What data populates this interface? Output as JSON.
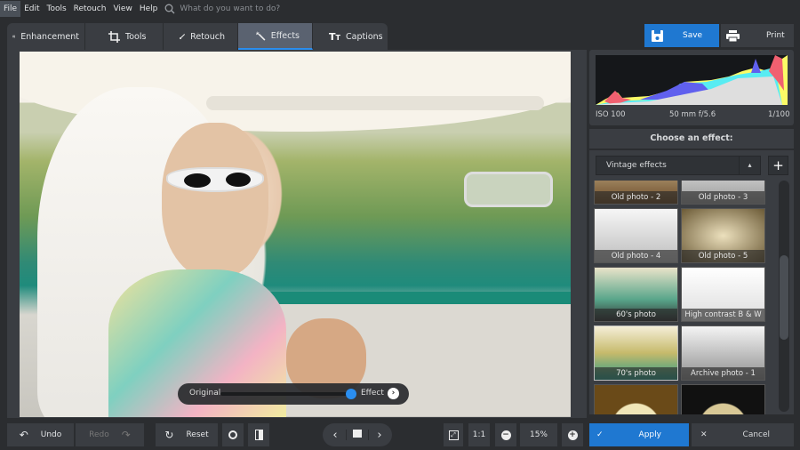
{
  "menu": {
    "items": [
      "File",
      "Edit",
      "Tools",
      "Retouch",
      "View",
      "Help"
    ],
    "active": "File",
    "search_placeholder": "What do you want to do?"
  },
  "tabs": [
    {
      "label": "Enhancement",
      "icon": "sliders-icon"
    },
    {
      "label": "Tools",
      "icon": "crop-icon"
    },
    {
      "label": "Retouch",
      "icon": "brush-icon"
    },
    {
      "label": "Effects",
      "icon": "magic-wand-icon",
      "active": true
    },
    {
      "label": "Captions",
      "icon": "text-icon"
    }
  ],
  "header": {
    "save_label": "Save",
    "print_label": "Print"
  },
  "histogram": {
    "iso": "ISO 100",
    "lens": "50 mm f/5.6",
    "shutter": "1/100"
  },
  "effects": {
    "heading": "Choose an effect:",
    "category": "Vintage effects",
    "add_label": "+",
    "thumbnails": [
      {
        "label": "Old photo - 2"
      },
      {
        "label": "Old photo - 3"
      },
      {
        "label": "Old photo - 4"
      },
      {
        "label": "Old photo - 5"
      },
      {
        "label": "60's photo"
      },
      {
        "label": "High contrast B & W"
      },
      {
        "label": "70's photo",
        "selected": true
      },
      {
        "label": "Archive photo - 1"
      },
      {
        "label": ""
      },
      {
        "label": ""
      }
    ],
    "scroll_position": 0.45
  },
  "compare": {
    "original_label": "Original",
    "effect_label": "Effect",
    "value_percent": 100
  },
  "bottom": {
    "undo": "Undo",
    "redo": "Redo",
    "reset": "Reset",
    "one_to_one": "1:1",
    "zoom": "15%",
    "apply": "Apply",
    "cancel": "Cancel"
  },
  "colors": {
    "accent": "#1f78d1",
    "panel": "#3a3d42",
    "background": "#2b2d30"
  }
}
